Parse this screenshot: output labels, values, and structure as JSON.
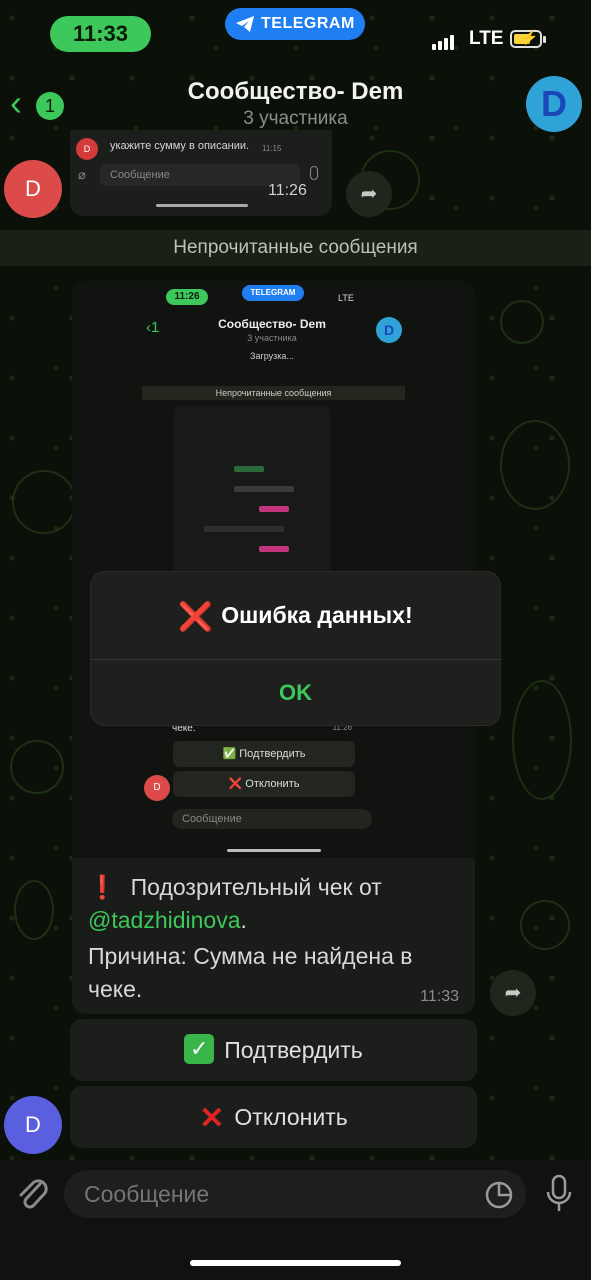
{
  "status_bar": {
    "time": "11:33",
    "app_pill": "TELEGRAM",
    "network": "LTE"
  },
  "header": {
    "back_badge": "1",
    "title": "Сообщество- Dem",
    "subtitle": "3 участника",
    "avatar_letter": "D"
  },
  "top_bubble": {
    "text": "укажите сумму в описании.",
    "small_time": "11:15",
    "input_placeholder": "Сообщение",
    "time": "11:26",
    "avatar_letter": "D"
  },
  "unread_bar": "Непрочитанные сообщения",
  "embedded_screenshot": {
    "time": "11:26",
    "app_pill": "TELEGRAM",
    "network": "LTE",
    "back_badge": "1",
    "title": "Сообщество- Dem",
    "subtitle": "3 участника",
    "avatar_letter": "D",
    "loading": "Загрузка...",
    "unread_bar": "Непрочитанные сообщения",
    "bubble_text": "чеке.",
    "bubble_time": "11:26",
    "confirm": "✅ Подтвердить",
    "reject": "❌ Отклонить",
    "sender_letter": "D",
    "input_placeholder": "Сообщение"
  },
  "alert": {
    "title_icon": "❌",
    "title": "Ошибка данных!",
    "ok_label": "OK"
  },
  "caption": {
    "icon": "❗",
    "line1": "Подозрительный чек от",
    "mention": "@tadzhidinova",
    "line2_suffix": ".",
    "line3": "Причина: Сумма не найдена в",
    "line4": "чеке.",
    "time": "11:33"
  },
  "buttons": {
    "confirm_icon": "✓",
    "confirm_label": "Подтвердить",
    "reject_icon": "✕",
    "reject_label": "Отклонить"
  },
  "sender_avatar_letter": "D",
  "input": {
    "placeholder": "Сообщение"
  },
  "colors": {
    "accent": "#3cc85a",
    "telegram_blue": "#1f7ef2",
    "error": "#e02424",
    "background": "#0b1009"
  }
}
